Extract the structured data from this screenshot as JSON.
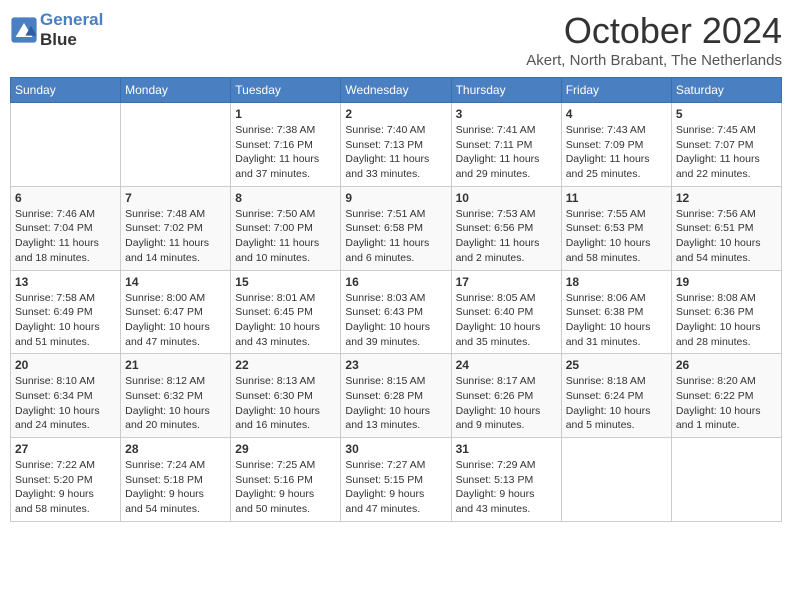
{
  "logo": {
    "line1": "General",
    "line2": "Blue"
  },
  "title": "October 2024",
  "location": "Akert, North Brabant, The Netherlands",
  "weekdays": [
    "Sunday",
    "Monday",
    "Tuesday",
    "Wednesday",
    "Thursday",
    "Friday",
    "Saturday"
  ],
  "weeks": [
    [
      {
        "day": "",
        "info": ""
      },
      {
        "day": "",
        "info": ""
      },
      {
        "day": "1",
        "info": "Sunrise: 7:38 AM\nSunset: 7:16 PM\nDaylight: 11 hours\nand 37 minutes."
      },
      {
        "day": "2",
        "info": "Sunrise: 7:40 AM\nSunset: 7:13 PM\nDaylight: 11 hours\nand 33 minutes."
      },
      {
        "day": "3",
        "info": "Sunrise: 7:41 AM\nSunset: 7:11 PM\nDaylight: 11 hours\nand 29 minutes."
      },
      {
        "day": "4",
        "info": "Sunrise: 7:43 AM\nSunset: 7:09 PM\nDaylight: 11 hours\nand 25 minutes."
      },
      {
        "day": "5",
        "info": "Sunrise: 7:45 AM\nSunset: 7:07 PM\nDaylight: 11 hours\nand 22 minutes."
      }
    ],
    [
      {
        "day": "6",
        "info": "Sunrise: 7:46 AM\nSunset: 7:04 PM\nDaylight: 11 hours\nand 18 minutes."
      },
      {
        "day": "7",
        "info": "Sunrise: 7:48 AM\nSunset: 7:02 PM\nDaylight: 11 hours\nand 14 minutes."
      },
      {
        "day": "8",
        "info": "Sunrise: 7:50 AM\nSunset: 7:00 PM\nDaylight: 11 hours\nand 10 minutes."
      },
      {
        "day": "9",
        "info": "Sunrise: 7:51 AM\nSunset: 6:58 PM\nDaylight: 11 hours\nand 6 minutes."
      },
      {
        "day": "10",
        "info": "Sunrise: 7:53 AM\nSunset: 6:56 PM\nDaylight: 11 hours\nand 2 minutes."
      },
      {
        "day": "11",
        "info": "Sunrise: 7:55 AM\nSunset: 6:53 PM\nDaylight: 10 hours\nand 58 minutes."
      },
      {
        "day": "12",
        "info": "Sunrise: 7:56 AM\nSunset: 6:51 PM\nDaylight: 10 hours\nand 54 minutes."
      }
    ],
    [
      {
        "day": "13",
        "info": "Sunrise: 7:58 AM\nSunset: 6:49 PM\nDaylight: 10 hours\nand 51 minutes."
      },
      {
        "day": "14",
        "info": "Sunrise: 8:00 AM\nSunset: 6:47 PM\nDaylight: 10 hours\nand 47 minutes."
      },
      {
        "day": "15",
        "info": "Sunrise: 8:01 AM\nSunset: 6:45 PM\nDaylight: 10 hours\nand 43 minutes."
      },
      {
        "day": "16",
        "info": "Sunrise: 8:03 AM\nSunset: 6:43 PM\nDaylight: 10 hours\nand 39 minutes."
      },
      {
        "day": "17",
        "info": "Sunrise: 8:05 AM\nSunset: 6:40 PM\nDaylight: 10 hours\nand 35 minutes."
      },
      {
        "day": "18",
        "info": "Sunrise: 8:06 AM\nSunset: 6:38 PM\nDaylight: 10 hours\nand 31 minutes."
      },
      {
        "day": "19",
        "info": "Sunrise: 8:08 AM\nSunset: 6:36 PM\nDaylight: 10 hours\nand 28 minutes."
      }
    ],
    [
      {
        "day": "20",
        "info": "Sunrise: 8:10 AM\nSunset: 6:34 PM\nDaylight: 10 hours\nand 24 minutes."
      },
      {
        "day": "21",
        "info": "Sunrise: 8:12 AM\nSunset: 6:32 PM\nDaylight: 10 hours\nand 20 minutes."
      },
      {
        "day": "22",
        "info": "Sunrise: 8:13 AM\nSunset: 6:30 PM\nDaylight: 10 hours\nand 16 minutes."
      },
      {
        "day": "23",
        "info": "Sunrise: 8:15 AM\nSunset: 6:28 PM\nDaylight: 10 hours\nand 13 minutes."
      },
      {
        "day": "24",
        "info": "Sunrise: 8:17 AM\nSunset: 6:26 PM\nDaylight: 10 hours\nand 9 minutes."
      },
      {
        "day": "25",
        "info": "Sunrise: 8:18 AM\nSunset: 6:24 PM\nDaylight: 10 hours\nand 5 minutes."
      },
      {
        "day": "26",
        "info": "Sunrise: 8:20 AM\nSunset: 6:22 PM\nDaylight: 10 hours\nand 1 minute."
      }
    ],
    [
      {
        "day": "27",
        "info": "Sunrise: 7:22 AM\nSunset: 5:20 PM\nDaylight: 9 hours\nand 58 minutes."
      },
      {
        "day": "28",
        "info": "Sunrise: 7:24 AM\nSunset: 5:18 PM\nDaylight: 9 hours\nand 54 minutes."
      },
      {
        "day": "29",
        "info": "Sunrise: 7:25 AM\nSunset: 5:16 PM\nDaylight: 9 hours\nand 50 minutes."
      },
      {
        "day": "30",
        "info": "Sunrise: 7:27 AM\nSunset: 5:15 PM\nDaylight: 9 hours\nand 47 minutes."
      },
      {
        "day": "31",
        "info": "Sunrise: 7:29 AM\nSunset: 5:13 PM\nDaylight: 9 hours\nand 43 minutes."
      },
      {
        "day": "",
        "info": ""
      },
      {
        "day": "",
        "info": ""
      }
    ]
  ]
}
